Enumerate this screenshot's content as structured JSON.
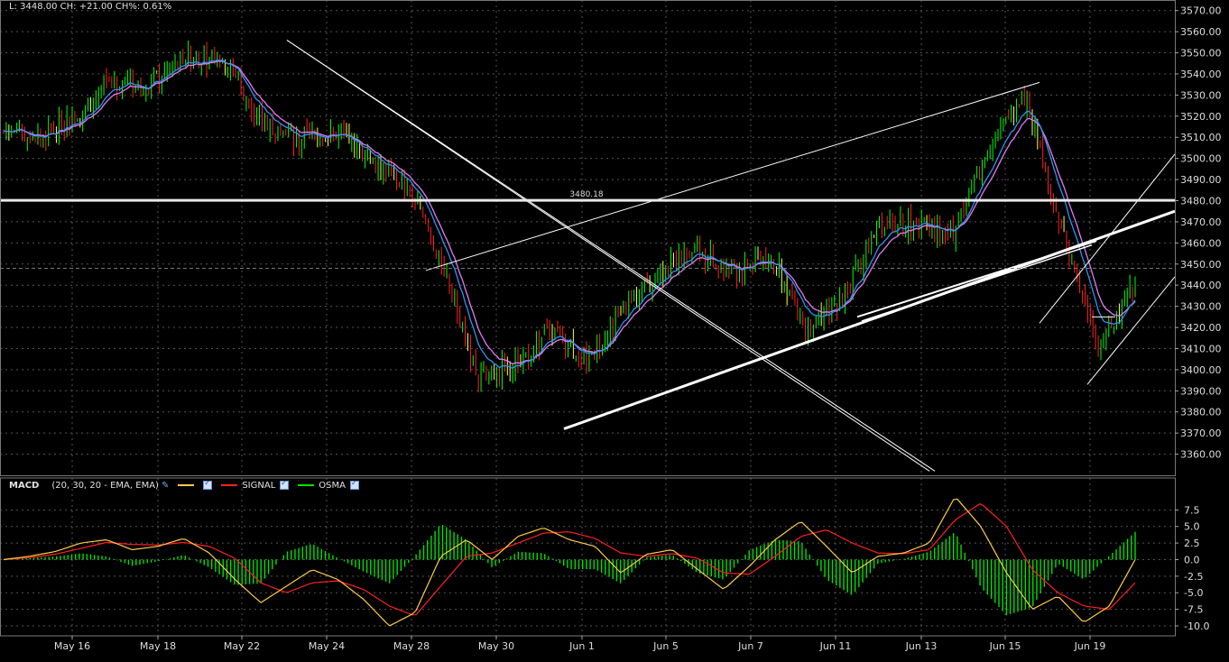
{
  "readout": {
    "text": "L: 3448.00 CH: +21.00 CH%: 0.61%"
  },
  "colors": {
    "up": "#00ff00",
    "down": "#ff2020",
    "fast_ma": "#2f93f0",
    "slow_ma": "#e07cf0",
    "macd": "#ffc94a",
    "signal": "#ff2020",
    "osma": "#00e000",
    "grid": "#555555",
    "trend": "#ffffff"
  },
  "macd_legend": {
    "title": "MACD",
    "params": "(20, 30, 20 - EMA, EMA)",
    "pen_icon": "pencil-icon",
    "items": [
      {
        "label": "",
        "color": "#ffc94a"
      },
      {
        "label": "SIGNAL",
        "color": "#ff2020"
      },
      {
        "label": "OSMA",
        "color": "#00e000"
      }
    ]
  },
  "chart_data": [
    {
      "type": "candlestick",
      "ylim": [
        3350,
        3575
      ],
      "yticks": [
        "3360.00",
        "3370.00",
        "3380.00",
        "3390.00",
        "3400.00",
        "3410.00",
        "3420.00",
        "3430.00",
        "3440.00",
        "3450.00",
        "3460.00",
        "3470.00",
        "3480.00",
        "3490.00",
        "3500.00",
        "3510.00",
        "3520.00",
        "3530.00",
        "3540.00",
        "3550.00",
        "3560.00",
        "3570.00"
      ],
      "ytick_values": [
        3360,
        3370,
        3380,
        3390,
        3400,
        3410,
        3420,
        3430,
        3440,
        3450,
        3460,
        3470,
        3480,
        3490,
        3500,
        3510,
        3520,
        3530,
        3540,
        3550,
        3560,
        3570
      ],
      "x_dates": [
        "May 16",
        "May 18",
        "May 22",
        "May 24",
        "May 28",
        "May 30",
        "Jun 1",
        "Jun 5",
        "Jun 7",
        "Jun 11",
        "Jun 13",
        "Jun 15",
        "Jun 19"
      ],
      "price_path": [
        [
          "May 15",
          3513
        ],
        [
          "May 16",
          3510
        ],
        [
          "May 17",
          3520
        ],
        [
          "May 18",
          3537
        ],
        [
          "May 19",
          3536
        ],
        [
          "May 21",
          3548
        ],
        [
          "May 22",
          3547
        ],
        [
          "May 23",
          3520
        ],
        [
          "May 23b",
          3508
        ],
        [
          "May 24",
          3513
        ],
        [
          "May 25",
          3500
        ],
        [
          "May 28",
          3488
        ],
        [
          "May 29",
          3452
        ],
        [
          "May 29b",
          3395
        ],
        [
          "May 30",
          3404
        ],
        [
          "May 31",
          3418
        ],
        [
          "Jun 1",
          3405
        ],
        [
          "Jun 1b",
          3430
        ],
        [
          "Jun 4",
          3447
        ],
        [
          "Jun 5",
          3457
        ],
        [
          "Jun 6",
          3445
        ],
        [
          "Jun 7",
          3455
        ],
        [
          "Jun 8",
          3420
        ],
        [
          "Jun 11",
          3435
        ],
        [
          "Jun 12",
          3468
        ],
        [
          "Jun 13",
          3470
        ],
        [
          "Jun 14",
          3465
        ],
        [
          "Jun 14b",
          3505
        ],
        [
          "Jun 15",
          3530
        ],
        [
          "Jun 18",
          3465
        ],
        [
          "Jun 19",
          3410
        ],
        [
          "Jun 20",
          3440
        ]
      ],
      "last_value": 3448,
      "horizontal_level": {
        "label": "3480.18",
        "value": 3480.18
      }
    },
    {
      "type": "macd",
      "ylim": [
        -11.5,
        10.0
      ],
      "yticks": [
        "7.5",
        "5.0",
        "2.5",
        "0.0",
        "-2.5",
        "-5.0",
        "-7.5",
        "-10.0"
      ],
      "ytick_values": [
        7.5,
        5.0,
        2.5,
        0.0,
        -2.5,
        -5.0,
        -7.5,
        -10.0
      ],
      "macd_path": [
        0,
        0.5,
        1.2,
        2.5,
        3.0,
        1.5,
        2.0,
        3.2,
        1.0,
        -3.0,
        -6.5,
        -4.0,
        -1.5,
        -3.0,
        -6.0,
        -10.0,
        -8.0,
        0.5,
        3.0,
        0.0,
        3.5,
        4.8,
        3.0,
        2.0,
        -2.0,
        0.8,
        1.5,
        -1.5,
        -4.5,
        -1.0,
        3.0,
        5.8,
        2.0,
        -2.0,
        0.5,
        1.0,
        2.5,
        9.5,
        5.0,
        -2.0,
        -7.5,
        -5.5,
        -9.5,
        -7.0,
        0.0
      ],
      "signal_path": [
        0,
        0.3,
        0.8,
        1.7,
        2.6,
        2.3,
        2.2,
        2.6,
        2.0,
        0.2,
        -3.5,
        -5.0,
        -3.5,
        -3.2,
        -4.5,
        -7.0,
        -8.5,
        -4.0,
        0.5,
        1.0,
        2.5,
        4.0,
        4.2,
        3.2,
        1.0,
        0.5,
        0.9,
        0.2,
        -2.0,
        -2.2,
        0.5,
        3.5,
        4.5,
        2.5,
        1.0,
        0.9,
        1.5,
        6.0,
        8.5,
        5.0,
        -1.5,
        -5.0,
        -7.0,
        -7.5,
        -3.5
      ]
    }
  ]
}
